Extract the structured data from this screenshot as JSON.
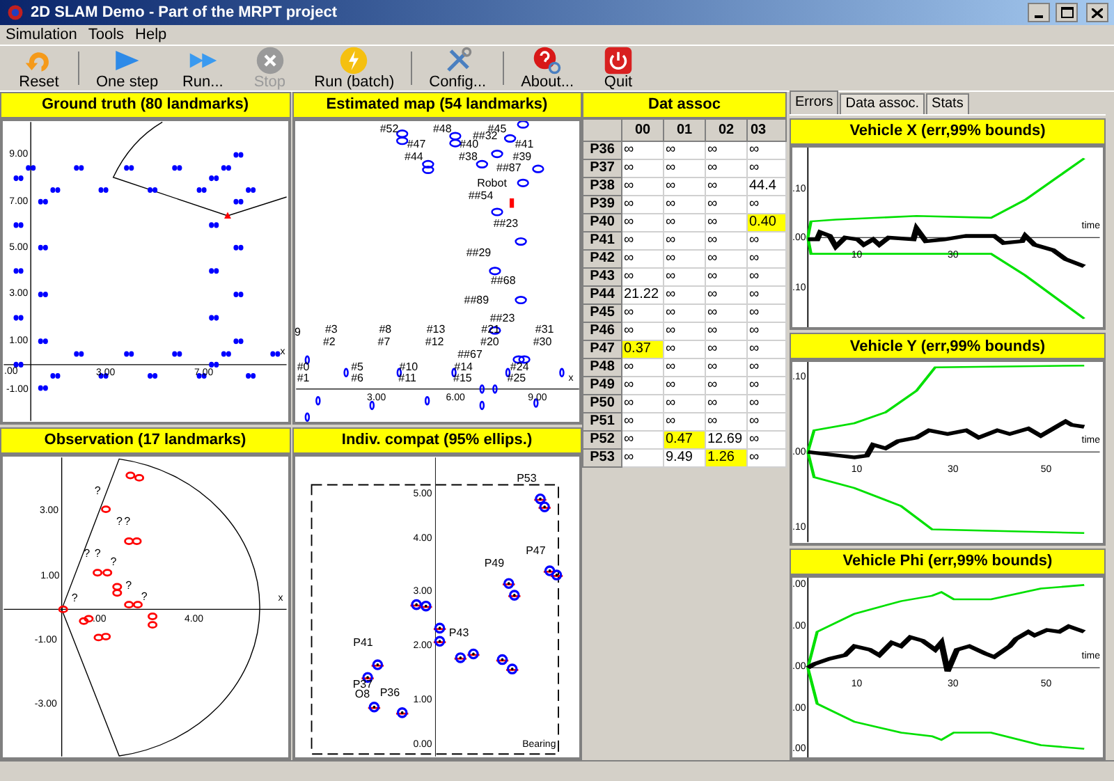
{
  "window": {
    "title": "2D SLAM Demo - Part of the MRPT project"
  },
  "menu": [
    "Simulation",
    "Tools",
    "Help"
  ],
  "toolbar": [
    {
      "kind": "reset",
      "label": "Reset",
      "disabled": false
    },
    {
      "kind": "step",
      "label": "One step",
      "disabled": false
    },
    {
      "kind": "run",
      "label": "Run...",
      "disabled": false
    },
    {
      "kind": "stop",
      "label": "Stop",
      "disabled": true
    },
    {
      "kind": "batch",
      "label": "Run (batch)",
      "disabled": false
    },
    {
      "kind": "config",
      "label": "Config...",
      "disabled": false
    },
    {
      "kind": "about",
      "label": "About...",
      "disabled": false
    },
    {
      "kind": "quit",
      "label": "Quit",
      "disabled": false
    }
  ],
  "map_panels": [
    {
      "kind": "ground_truth",
      "title": "Ground truth (80 landmarks)",
      "ticks": [
        "9.00",
        "7.00",
        "5.00",
        "3.00",
        "1.00",
        "x",
        ".00",
        "3.00",
        "7.00",
        "-1.00"
      ]
    },
    {
      "kind": "estimated_map",
      "title": "Estimated map (54 landmarks)",
      "ticks": [
        "3.00",
        "6.00",
        "9.00",
        "x"
      ],
      "point_labels": [
        "#52",
        "#48",
        "#45",
        "#47",
        "#44",
        "#40",
        "##32",
        "#38",
        "#41",
        "#39",
        "##87",
        "Robot",
        "##54",
        "##23",
        "##29",
        "##68",
        "##89",
        "##23",
        "9",
        "#3",
        "#2",
        "#8",
        "#7",
        "#13",
        "#12",
        "#21",
        "#20",
        "#31",
        "#30",
        "##67",
        "#0",
        "#1",
        "#5",
        "#6",
        "#10",
        "#11",
        "#14",
        "#15",
        "#24",
        "#25"
      ]
    },
    {
      "kind": "observation",
      "title": "Observation (17 landmarks)",
      "ticks": [
        "3.00",
        "1.00",
        "-1.00",
        "-3.00",
        ".00",
        "4.00",
        "x"
      ],
      "point_labels": [
        "?",
        "?",
        "?",
        "?",
        "?",
        "?",
        "?",
        "?",
        "?"
      ]
    },
    {
      "kind": "compatibility",
      "title": "Indiv. compat (95% ellips.)",
      "ticks": [
        "5.00",
        "4.00",
        "3.00",
        "2.00",
        "1.00",
        "0.00",
        "Bearing"
      ],
      "point_labels": [
        "P53",
        "P47",
        "P49",
        "P43",
        "P41",
        "P37",
        "O8",
        "P36"
      ]
    }
  ],
  "dat_assoc": {
    "title": "Dat assoc",
    "columns": [
      "00",
      "01",
      "02",
      "03"
    ],
    "rows": [
      {
        "label": "P36",
        "cells": [
          {
            "text": "∞",
            "highlighted": false
          },
          {
            "text": "∞",
            "highlighted": false
          },
          {
            "text": "∞",
            "highlighted": false
          },
          {
            "text": "∞",
            "highlighted": false
          }
        ]
      },
      {
        "label": "P37",
        "cells": [
          {
            "text": "∞",
            "highlighted": false
          },
          {
            "text": "∞",
            "highlighted": false
          },
          {
            "text": "∞",
            "highlighted": false
          },
          {
            "text": "∞",
            "highlighted": false
          }
        ]
      },
      {
        "label": "P38",
        "cells": [
          {
            "text": "∞",
            "highlighted": false
          },
          {
            "text": "∞",
            "highlighted": false
          },
          {
            "text": "∞",
            "highlighted": false
          },
          {
            "text": "44.4",
            "highlighted": false
          }
        ]
      },
      {
        "label": "P39",
        "cells": [
          {
            "text": "∞",
            "highlighted": false
          },
          {
            "text": "∞",
            "highlighted": false
          },
          {
            "text": "∞",
            "highlighted": false
          },
          {
            "text": "∞",
            "highlighted": false
          }
        ]
      },
      {
        "label": "P40",
        "cells": [
          {
            "text": "∞",
            "highlighted": false
          },
          {
            "text": "∞",
            "highlighted": false
          },
          {
            "text": "∞",
            "highlighted": false
          },
          {
            "text": "0.40",
            "highlighted": true
          }
        ]
      },
      {
        "label": "P41",
        "cells": [
          {
            "text": "∞",
            "highlighted": false
          },
          {
            "text": "∞",
            "highlighted": false
          },
          {
            "text": "∞",
            "highlighted": false
          },
          {
            "text": "∞",
            "highlighted": false
          }
        ]
      },
      {
        "label": "P42",
        "cells": [
          {
            "text": "∞",
            "highlighted": false
          },
          {
            "text": "∞",
            "highlighted": false
          },
          {
            "text": "∞",
            "highlighted": false
          },
          {
            "text": "∞",
            "highlighted": false
          }
        ]
      },
      {
        "label": "P43",
        "cells": [
          {
            "text": "∞",
            "highlighted": false
          },
          {
            "text": "∞",
            "highlighted": false
          },
          {
            "text": "∞",
            "highlighted": false
          },
          {
            "text": "∞",
            "highlighted": false
          }
        ]
      },
      {
        "label": "P44",
        "cells": [
          {
            "text": "21.22",
            "highlighted": false
          },
          {
            "text": "∞",
            "highlighted": false
          },
          {
            "text": "∞",
            "highlighted": false
          },
          {
            "text": "∞",
            "highlighted": false
          }
        ]
      },
      {
        "label": "P45",
        "cells": [
          {
            "text": "∞",
            "highlighted": false
          },
          {
            "text": "∞",
            "highlighted": false
          },
          {
            "text": "∞",
            "highlighted": false
          },
          {
            "text": "∞",
            "highlighted": false
          }
        ]
      },
      {
        "label": "P46",
        "cells": [
          {
            "text": "∞",
            "highlighted": false
          },
          {
            "text": "∞",
            "highlighted": false
          },
          {
            "text": "∞",
            "highlighted": false
          },
          {
            "text": "∞",
            "highlighted": false
          }
        ]
      },
      {
        "label": "P47",
        "cells": [
          {
            "text": "0.37",
            "highlighted": true
          },
          {
            "text": "∞",
            "highlighted": false
          },
          {
            "text": "∞",
            "highlighted": false
          },
          {
            "text": "∞",
            "highlighted": false
          }
        ]
      },
      {
        "label": "P48",
        "cells": [
          {
            "text": "∞",
            "highlighted": false
          },
          {
            "text": "∞",
            "highlighted": false
          },
          {
            "text": "∞",
            "highlighted": false
          },
          {
            "text": "∞",
            "highlighted": false
          }
        ]
      },
      {
        "label": "P49",
        "cells": [
          {
            "text": "∞",
            "highlighted": false
          },
          {
            "text": "∞",
            "highlighted": false
          },
          {
            "text": "∞",
            "highlighted": false
          },
          {
            "text": "∞",
            "highlighted": false
          }
        ]
      },
      {
        "label": "P50",
        "cells": [
          {
            "text": "∞",
            "highlighted": false
          },
          {
            "text": "∞",
            "highlighted": false
          },
          {
            "text": "∞",
            "highlighted": false
          },
          {
            "text": "∞",
            "highlighted": false
          }
        ]
      },
      {
        "label": "P51",
        "cells": [
          {
            "text": "∞",
            "highlighted": false
          },
          {
            "text": "∞",
            "highlighted": false
          },
          {
            "text": "∞",
            "highlighted": false
          },
          {
            "text": "∞",
            "highlighted": false
          }
        ]
      },
      {
        "label": "P52",
        "cells": [
          {
            "text": "∞",
            "highlighted": false
          },
          {
            "text": "0.47",
            "highlighted": true
          },
          {
            "text": "12.69",
            "highlighted": false
          },
          {
            "text": "∞",
            "highlighted": false
          }
        ]
      },
      {
        "label": "P53",
        "cells": [
          {
            "text": "∞",
            "highlighted": false
          },
          {
            "text": "9.49",
            "highlighted": false
          },
          {
            "text": "1.26",
            "highlighted": true
          },
          {
            "text": "∞",
            "highlighted": false
          }
        ]
      }
    ]
  },
  "tabs": [
    {
      "label": "Errors",
      "selected": true
    },
    {
      "label": "Data assoc.",
      "selected": false
    },
    {
      "label": "Stats",
      "selected": false
    }
  ],
  "error_plots": [
    {
      "kind": "x",
      "title": "Vehicle X (err,99% bounds)",
      "y_ticks": [
        ".10",
        ".00",
        ".10"
      ],
      "x_ticks": [
        "10",
        "30"
      ],
      "axis_label": "time"
    },
    {
      "kind": "y",
      "title": "Vehicle Y (err,99% bounds)",
      "y_ticks": [
        ".10",
        ".00",
        ".10"
      ],
      "x_ticks": [
        "10",
        "30",
        "50"
      ],
      "axis_label": "time"
    },
    {
      "kind": "phi",
      "title": "Vehicle Phi (err,99% bounds)",
      "y_ticks": [
        ".00",
        ".00",
        ".00",
        ".00",
        ".00"
      ],
      "x_ticks": [
        "10",
        "30",
        "50"
      ],
      "axis_label": "time"
    }
  ]
}
